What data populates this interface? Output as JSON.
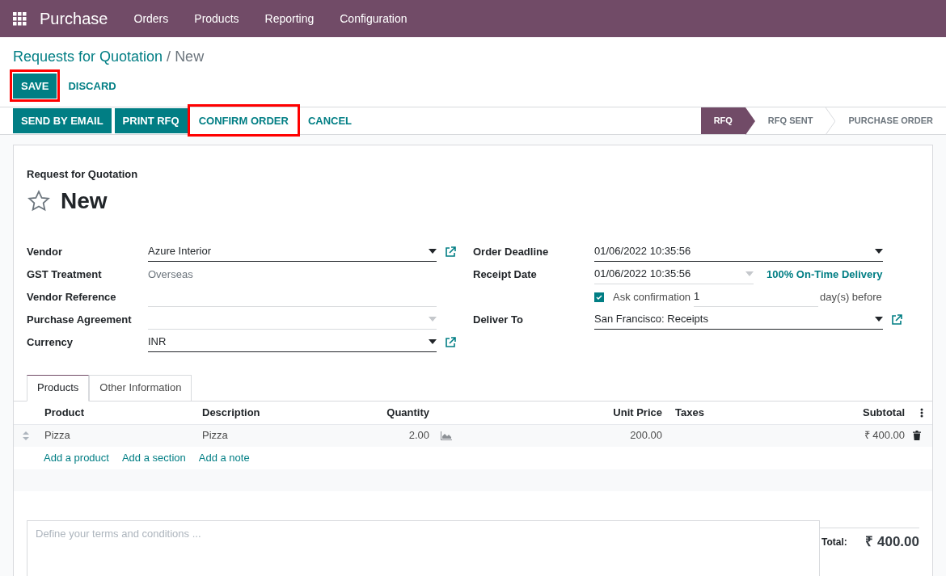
{
  "app": {
    "name": "Purchase",
    "menu": [
      "Orders",
      "Products",
      "Reporting",
      "Configuration"
    ]
  },
  "breadcrumb": {
    "parent": "Requests for Quotation",
    "separator": "/",
    "current": "New"
  },
  "edit_buttons": [
    {
      "label": "SAVE",
      "kind": "primary",
      "highlighted": true
    },
    {
      "label": "DISCARD",
      "kind": "link",
      "highlighted": false
    }
  ],
  "actions": [
    {
      "label": "SEND BY EMAIL",
      "kind": "primary",
      "highlighted": false
    },
    {
      "label": "PRINT RFQ",
      "kind": "primary",
      "highlighted": false
    },
    {
      "label": "CONFIRM ORDER",
      "kind": "link",
      "highlighted": true
    },
    {
      "label": "CANCEL",
      "kind": "link",
      "highlighted": false
    }
  ],
  "stages": [
    {
      "label": "RFQ",
      "selected": true
    },
    {
      "label": "RFQ SENT",
      "selected": false
    },
    {
      "label": "PURCHASE ORDER",
      "selected": false
    }
  ],
  "document": {
    "type_label": "Request for Quotation",
    "name": "New",
    "starred": false
  },
  "left_fields": [
    {
      "label": "Vendor",
      "value": "Azure Interior",
      "kind": "many2one",
      "external_link": true
    },
    {
      "label": "GST Treatment",
      "value": "Overseas",
      "kind": "readonly"
    },
    {
      "label": "Vendor Reference",
      "kind": "text"
    },
    {
      "label": "Purchase Agreement",
      "kind": "select_disabled"
    },
    {
      "label": "Currency",
      "value": "INR",
      "kind": "many2one",
      "external_link": true
    }
  ],
  "right_fields": [
    {
      "label": "Order Deadline",
      "value": "01/06/2022 10:35:56",
      "kind": "date"
    },
    {
      "label": "Receipt Date",
      "value": "01/06/2022 10:35:56",
      "kind": "date_muted",
      "badge": "100% On-Time Delivery"
    },
    {
      "kind": "checkbox",
      "checked": true,
      "text": "Ask confirmation",
      "value": "1",
      "suffix": "day(s) before"
    },
    {
      "label": "Deliver To",
      "value": "San Francisco: Receipts",
      "kind": "many2one",
      "external_link": true
    }
  ],
  "tabs": [
    {
      "label": "Products",
      "selected": true
    },
    {
      "label": "Other Information",
      "selected": false
    }
  ],
  "table": {
    "columns": [
      {
        "label": "Product"
      },
      {
        "label": "Description"
      },
      {
        "label": "Quantity"
      },
      {
        "label": "Unit Price"
      },
      {
        "label": "Taxes"
      },
      {
        "label": "Subtotal"
      }
    ],
    "rows": [
      {
        "product": "Pizza",
        "description": "Pizza",
        "quantity": "2.00",
        "unit_price": "200.00",
        "subtotal": "₹ 400.00"
      }
    ],
    "add_links": [
      "Add a product",
      "Add a section",
      "Add a note"
    ]
  },
  "notes": {
    "placeholder": "Define your terms and conditions ..."
  },
  "total": {
    "label": "Total:",
    "value": "₹ 400.00"
  }
}
